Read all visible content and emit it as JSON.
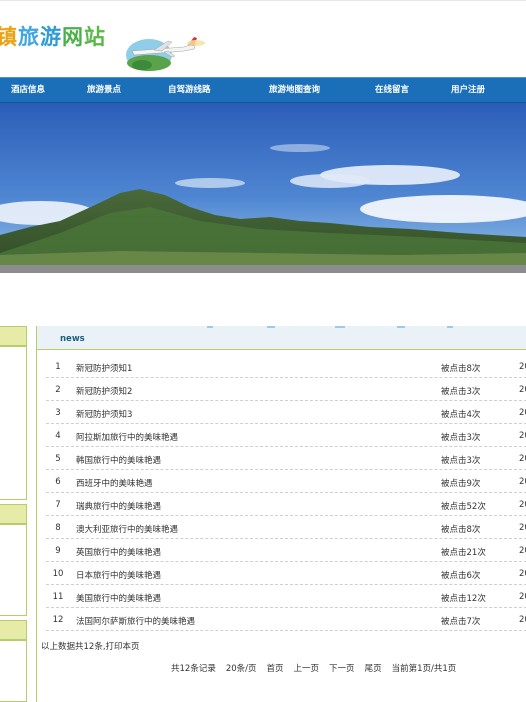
{
  "header": {
    "title_chars": [
      {
        "char": "镇",
        "color": "#e8a317"
      },
      {
        "char": "旅",
        "color": "#3fa7e0"
      },
      {
        "char": "游",
        "color": "#2e9bd6"
      },
      {
        "char": "网",
        "color": "#4cb04a"
      },
      {
        "char": "站",
        "color": "#58b848"
      }
    ]
  },
  "nav": {
    "items": [
      "酒店信息",
      "旅游景点",
      "自驾游线路",
      "旅游地图查询",
      "在线留言",
      "用户注册"
    ]
  },
  "news": {
    "section_title": "news",
    "rows": [
      {
        "num": "1",
        "title": "新冠防护须知1",
        "clicks": "被点击8次",
        "year": "20"
      },
      {
        "num": "2",
        "title": "新冠防护须知2",
        "clicks": "被点击3次",
        "year": "20"
      },
      {
        "num": "3",
        "title": "新冠防护须知3",
        "clicks": "被点击4次",
        "year": "20"
      },
      {
        "num": "4",
        "title": "阿拉斯加旅行中的美味艳遇",
        "clicks": "被点击3次",
        "year": "20"
      },
      {
        "num": "5",
        "title": "韩国旅行中的美味艳遇",
        "clicks": "被点击3次",
        "year": "20"
      },
      {
        "num": "6",
        "title": "西班牙中的美味艳遇",
        "clicks": "被点击9次",
        "year": "20"
      },
      {
        "num": "7",
        "title": "瑞典旅行中的美味艳遇",
        "clicks": "被点击52次",
        "year": "20"
      },
      {
        "num": "8",
        "title": "澳大利亚旅行中的美味艳遇",
        "clicks": "被点击8次",
        "year": "20"
      },
      {
        "num": "9",
        "title": "英国旅行中的美味艳遇",
        "clicks": "被点击21次",
        "year": "20"
      },
      {
        "num": "10",
        "title": "日本旅行中的美味艳遇",
        "clicks": "被点击6次",
        "year": "20"
      },
      {
        "num": "11",
        "title": "美国旅行中的美味艳遇",
        "clicks": "被点击12次",
        "year": "20"
      },
      {
        "num": "12",
        "title": "法国阿尔萨斯旅行中的美味艳遇",
        "clicks": "被点击7次",
        "year": "20"
      }
    ],
    "summary": "以上数据共12条,打印本页"
  },
  "pager": {
    "total": "共12条记录",
    "per_page": "20条/页",
    "first": "首页",
    "prev": "上一页",
    "next": "下一页",
    "last": "尾页",
    "current": "当前第1页/共1页"
  },
  "colors": {
    "nav_bg": "#1a6fb8",
    "side_accent": "#e6eca8",
    "side_border": "#b8cc6a",
    "news_header_bg": "#eaf2f8"
  }
}
